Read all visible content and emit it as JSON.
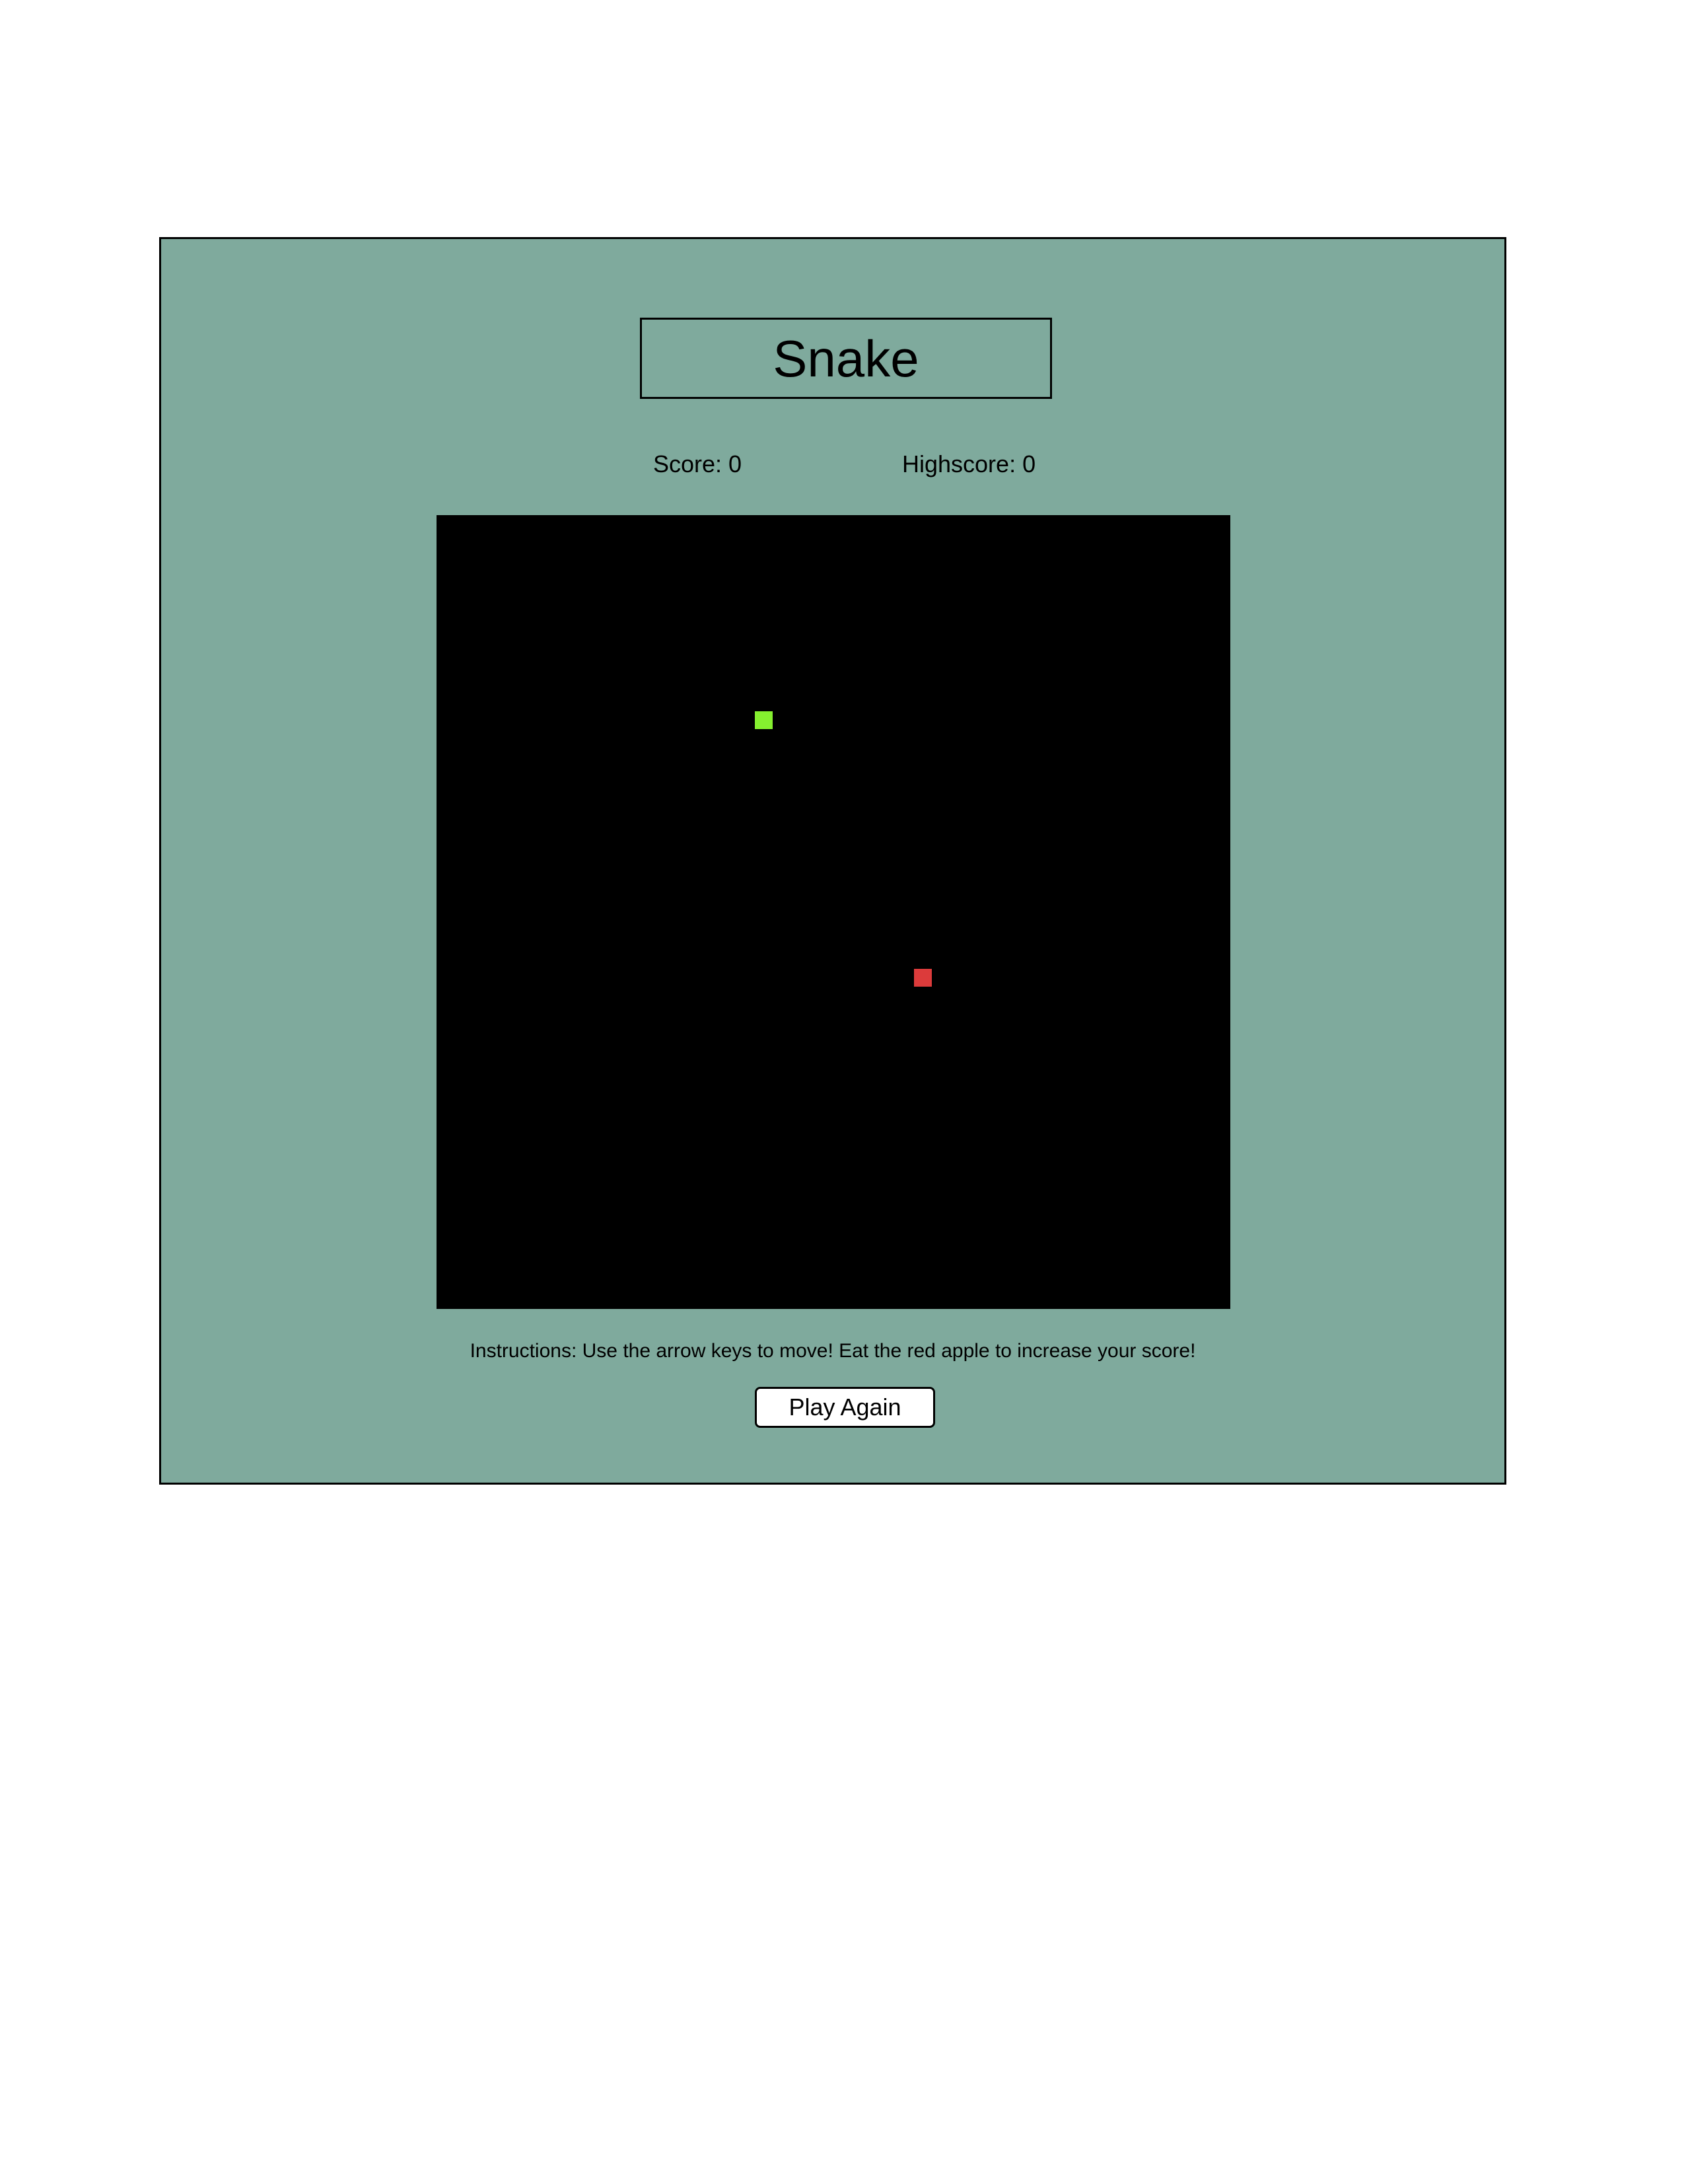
{
  "game": {
    "title": "Snake",
    "score_text": "Score: 0",
    "highscore_text": "Highscore: 0",
    "instructions": "Instructions: Use the arrow keys to move! Eat the red apple to increase your score!",
    "play_again_label": "Play Again"
  },
  "colors": {
    "panel_background": "#7faa9d",
    "board_background": "#000000",
    "snake": "#85f02f",
    "apple": "#dc3b3b"
  }
}
